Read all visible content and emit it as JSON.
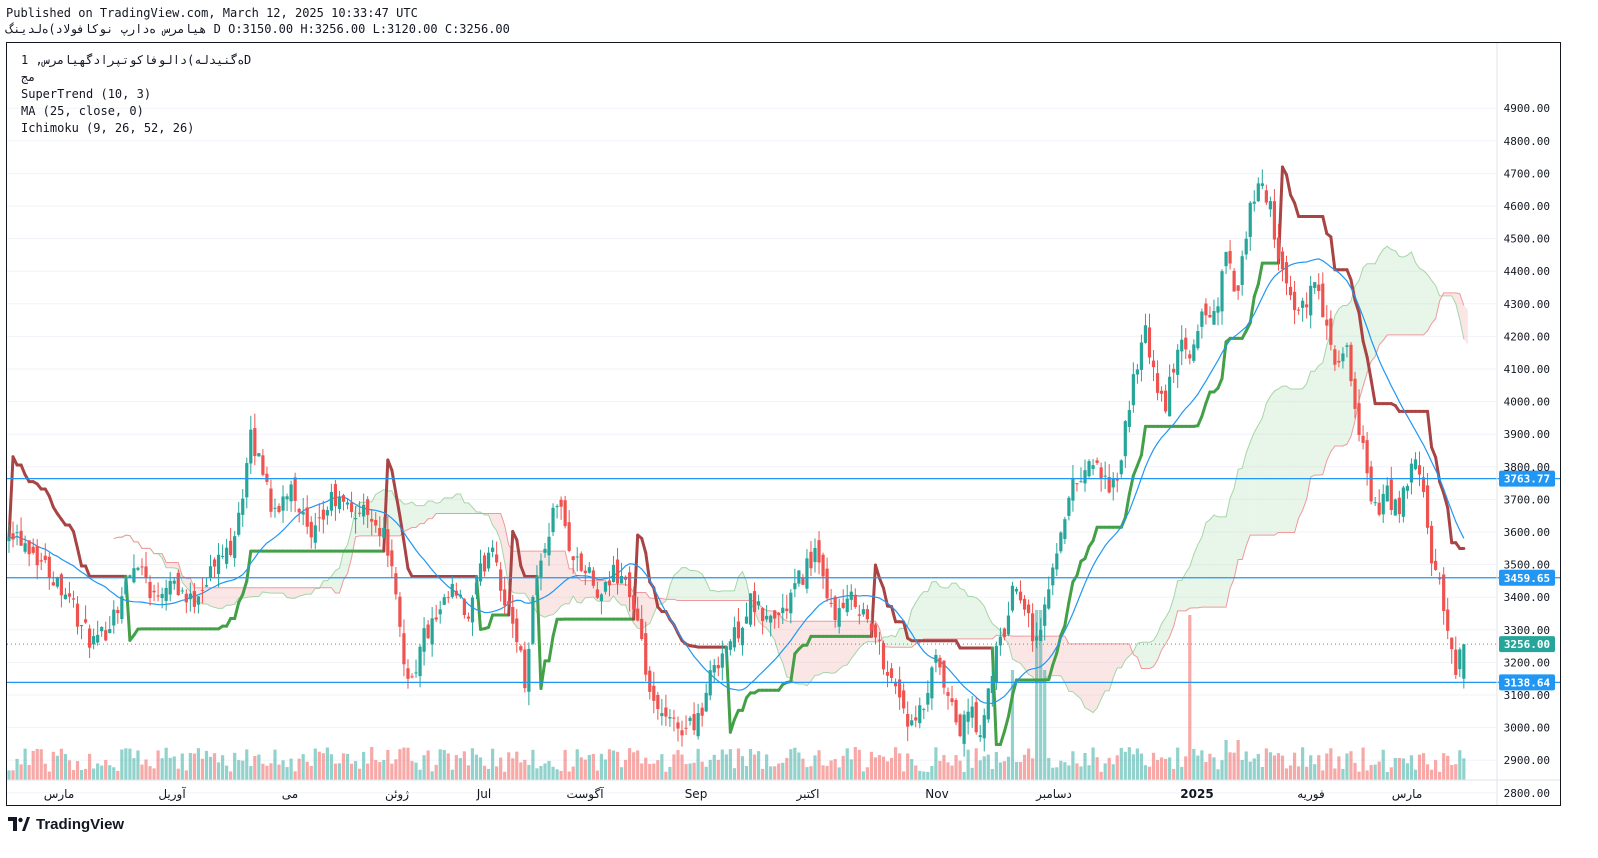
{
  "header": {
    "published": "Published on TradingView.com, March 12, 2025 10:33:47 UTC",
    "symbol": "هیامرس ەدارپ نوکافولاد)ەلدینگ",
    "ohlc": "D O:3150.00 H:3256.00 L:3120.00 C:3256.00"
  },
  "legend": {
    "title": "ەگنیدله)دالوفاکوتپرادگهیامرس, 1D",
    "subtitle": "مج",
    "indicators": [
      "SuperTrend (10, 3)",
      "MA (25, close, 0)",
      "Ichimoku (9, 26, 52, 26)"
    ]
  },
  "brand": {
    "name": "TradingView"
  },
  "colors": {
    "up": "#26a69a",
    "down": "#ef5350",
    "supertrend_up": "#43a047",
    "supertrend_down": "#a84444",
    "ma": "#2196f3",
    "hline": "#2196f3",
    "cloud_bull": "#a5d6a7",
    "cloud_bear": "#ef9a9a"
  },
  "chart_data": {
    "type": "candlestick",
    "yaxis": {
      "ticks": [
        2800,
        2900,
        3000,
        3100,
        3200,
        3300,
        3400,
        3500,
        3600,
        3700,
        3800,
        3900,
        4000,
        4100,
        4200,
        4300,
        4400,
        4500,
        4600,
        4700,
        4800,
        4900
      ],
      "range": [
        2750,
        4980
      ]
    },
    "xaxis": {
      "labels": [
        "مارس",
        "آوریل",
        "می",
        "ژوئن",
        "Jul",
        "آگوست",
        "Sep",
        "اکتبر",
        "Nov",
        "دسامبر",
        "2025",
        "فوریه",
        "مارس"
      ]
    },
    "hlines": [
      {
        "value": 3763.77,
        "label": "3763.77"
      },
      {
        "value": 3459.65,
        "label": "3459.65"
      },
      {
        "value": 3138.64,
        "label": "3138.64"
      }
    ],
    "last_price": {
      "value": 3256.0,
      "label": "3256.00"
    },
    "path": [
      [
        0,
        3620
      ],
      [
        5,
        3560
      ],
      [
        10,
        3480
      ],
      [
        15,
        3410
      ],
      [
        18,
        3300
      ],
      [
        22,
        3250
      ],
      [
        27,
        3380
      ],
      [
        32,
        3520
      ],
      [
        36,
        3400
      ],
      [
        40,
        3470
      ],
      [
        45,
        3380
      ],
      [
        50,
        3480
      ],
      [
        55,
        3560
      ],
      [
        58,
        3720
      ],
      [
        60,
        3880
      ],
      [
        63,
        3800
      ],
      [
        66,
        3640
      ],
      [
        70,
        3760
      ],
      [
        75,
        3560
      ],
      [
        80,
        3700
      ],
      [
        86,
        3660
      ],
      [
        90,
        3660
      ],
      [
        94,
        3560
      ],
      [
        98,
        3200
      ],
      [
        100,
        3150
      ],
      [
        103,
        3280
      ],
      [
        107,
        3340
      ],
      [
        110,
        3420
      ],
      [
        114,
        3330
      ],
      [
        117,
        3470
      ],
      [
        120,
        3580
      ],
      [
        123,
        3380
      ],
      [
        126,
        3290
      ],
      [
        128,
        3140
      ],
      [
        130,
        3400
      ],
      [
        133,
        3560
      ],
      [
        136,
        3700
      ],
      [
        140,
        3520
      ],
      [
        144,
        3460
      ],
      [
        147,
        3380
      ],
      [
        150,
        3480
      ],
      [
        153,
        3460
      ],
      [
        156,
        3300
      ],
      [
        160,
        3050
      ],
      [
        164,
        3010
      ],
      [
        168,
        3000
      ],
      [
        172,
        3050
      ],
      [
        175,
        3200
      ],
      [
        180,
        3280
      ],
      [
        184,
        3380
      ],
      [
        188,
        3330
      ],
      [
        192,
        3350
      ],
      [
        196,
        3450
      ],
      [
        200,
        3540
      ],
      [
        203,
        3380
      ],
      [
        206,
        3350
      ],
      [
        210,
        3400
      ],
      [
        214,
        3300
      ],
      [
        218,
        3180
      ],
      [
        221,
        3100
      ],
      [
        224,
        2990
      ],
      [
        227,
        3060
      ],
      [
        230,
        3200
      ],
      [
        233,
        3080
      ],
      [
        236,
        2990
      ],
      [
        239,
        3060
      ],
      [
        241,
        2950
      ],
      [
        244,
        3180
      ],
      [
        247,
        3300
      ],
      [
        250,
        3460
      ],
      [
        253,
        3340
      ],
      [
        255,
        3260
      ],
      [
        258,
        3420
      ],
      [
        261,
        3620
      ],
      [
        264,
        3740
      ],
      [
        267,
        3800
      ],
      [
        270,
        3820
      ],
      [
        273,
        3700
      ],
      [
        276,
        3820
      ],
      [
        279,
        4080
      ],
      [
        282,
        4200
      ],
      [
        284,
        4080
      ],
      [
        287,
        3980
      ],
      [
        290,
        4180
      ],
      [
        293,
        4120
      ],
      [
        296,
        4280
      ],
      [
        299,
        4260
      ],
      [
        302,
        4440
      ],
      [
        305,
        4320
      ],
      [
        308,
        4600
      ],
      [
        311,
        4660
      ],
      [
        313,
        4600
      ],
      [
        316,
        4380
      ],
      [
        319,
        4260
      ],
      [
        322,
        4300
      ],
      [
        324,
        4400
      ],
      [
        327,
        4200
      ],
      [
        330,
        4100
      ],
      [
        332,
        4150
      ],
      [
        334,
        3950
      ],
      [
        336,
        3880
      ],
      [
        338,
        3700
      ],
      [
        340,
        3660
      ],
      [
        342,
        3720
      ],
      [
        345,
        3650
      ],
      [
        347,
        3760
      ],
      [
        349,
        3820
      ],
      [
        351,
        3700
      ],
      [
        353,
        3520
      ],
      [
        355,
        3420
      ],
      [
        357,
        3300
      ],
      [
        359,
        3180
      ],
      [
        361,
        3256
      ]
    ]
  }
}
